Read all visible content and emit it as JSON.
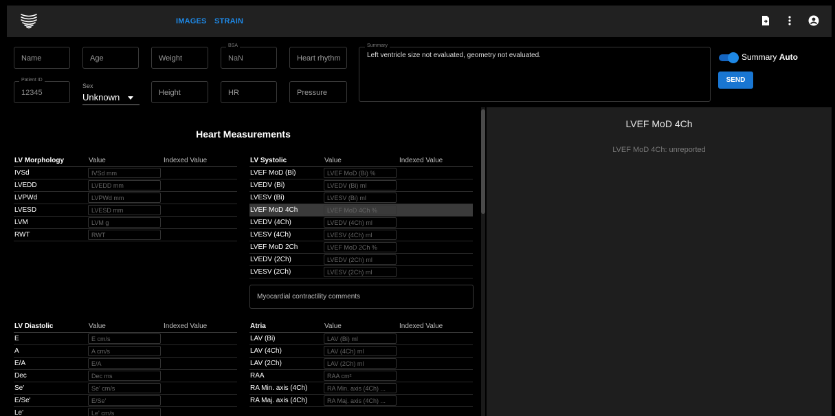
{
  "nav": {
    "images_label": "IMAGES",
    "strain_label": "STRAIN"
  },
  "icons": {
    "export": "file-export-icon",
    "menu": "more-vertical-icon",
    "account": "account-circle-icon",
    "logo": "heart-logo-icon"
  },
  "form": {
    "name_placeholder": "Name",
    "age_placeholder": "Age",
    "weight_placeholder": "Weight",
    "bsa_label": "BSA",
    "bsa_value": "NaN",
    "heart_rhythm_placeholder": "Heart rhythm",
    "patient_id_label": "Patient ID",
    "patient_id_value": "12345",
    "sex_label": "Sex",
    "sex_value": "Unknown",
    "height_placeholder": "Height",
    "hr_placeholder": "HR",
    "pressure_placeholder": "Pressure",
    "summary_label": "Summary",
    "summary_text": "Left ventricle size not evaluated, geometry not evaluated."
  },
  "summary_toggle": {
    "label": "Summary",
    "mode": "Auto",
    "on": true
  },
  "send_label": "SEND",
  "measurements": {
    "title": "Heart Measurements",
    "col_value": "Value",
    "col_indexed": "Indexed Value",
    "lv_morphology": {
      "title": "LV Morphology",
      "rows": [
        {
          "label": "IVSd",
          "placeholder": "IVSd mm"
        },
        {
          "label": "LVEDD",
          "placeholder": "LVEDD mm"
        },
        {
          "label": "LVPWd",
          "placeholder": "LVPWd mm"
        },
        {
          "label": "LVESD",
          "placeholder": "LVESD mm"
        },
        {
          "label": "LVM",
          "placeholder": "LVM g"
        },
        {
          "label": "RWT",
          "placeholder": "RWT"
        }
      ]
    },
    "lv_systolic": {
      "title": "LV Systolic",
      "rows": [
        {
          "label": "LVEF MoD (Bi)",
          "placeholder": "LVEF MoD (Bi) %"
        },
        {
          "label": "LVEDV (Bi)",
          "placeholder": "LVEDV (Bi) ml"
        },
        {
          "label": "LVESV (Bi)",
          "placeholder": "LVESV (Bi) ml"
        },
        {
          "label": "LVEF MoD 4Ch",
          "placeholder": "LVEF MoD 4Ch %"
        },
        {
          "label": "LVEDV (4Ch)",
          "placeholder": "LVEDV (4Ch) ml"
        },
        {
          "label": "LVESV (4Ch)",
          "placeholder": "LVESV (4Ch) ml"
        },
        {
          "label": "LVEF MoD 2Ch",
          "placeholder": "LVEF MoD 2Ch %"
        },
        {
          "label": "LVEDV (2Ch)",
          "placeholder": "LVEDV (2Ch) ml"
        },
        {
          "label": "LVESV (2Ch)",
          "placeholder": "LVESV (2Ch) ml"
        }
      ],
      "comments_placeholder": "Myocardial contractility comments"
    },
    "lv_diastolic": {
      "title": "LV Diastolic",
      "rows": [
        {
          "label": "E",
          "placeholder": "E cm/s"
        },
        {
          "label": "A",
          "placeholder": "A cm/s"
        },
        {
          "label": "E/A",
          "placeholder": "E/A"
        },
        {
          "label": "Dec",
          "placeholder": "Dec ms"
        },
        {
          "label": "Se'",
          "placeholder": "Se' cm/s"
        },
        {
          "label": "E/Se'",
          "placeholder": "E/Se'"
        },
        {
          "label": "Le'",
          "placeholder": "Le' cm/s"
        }
      ]
    },
    "atria": {
      "title": "Atria",
      "rows": [
        {
          "label": "LAV (Bi)",
          "placeholder": "LAV (Bi) ml"
        },
        {
          "label": "LAV (4Ch)",
          "placeholder": "LAV (4Ch) ml"
        },
        {
          "label": "LAV (2Ch)",
          "placeholder": "LAV (2Ch) ml"
        },
        {
          "label": "RAA",
          "placeholder": "RAA cm²"
        },
        {
          "label": "RA Min. axis (4Ch)",
          "placeholder": "RA Min. axis (4Ch) ..."
        },
        {
          "label": "RA Maj. axis (4Ch)",
          "placeholder": "RA Maj. axis (4Ch) ..."
        }
      ]
    }
  },
  "detail_panel": {
    "title": "LVEF MoD 4Ch",
    "subtitle": "LVEF MoD 4Ch: unreported"
  },
  "colors": {
    "accent": "#1e88e5",
    "topbar": "#212121",
    "panel": "#1e1e1e",
    "highlight": "#3a3a3a"
  }
}
